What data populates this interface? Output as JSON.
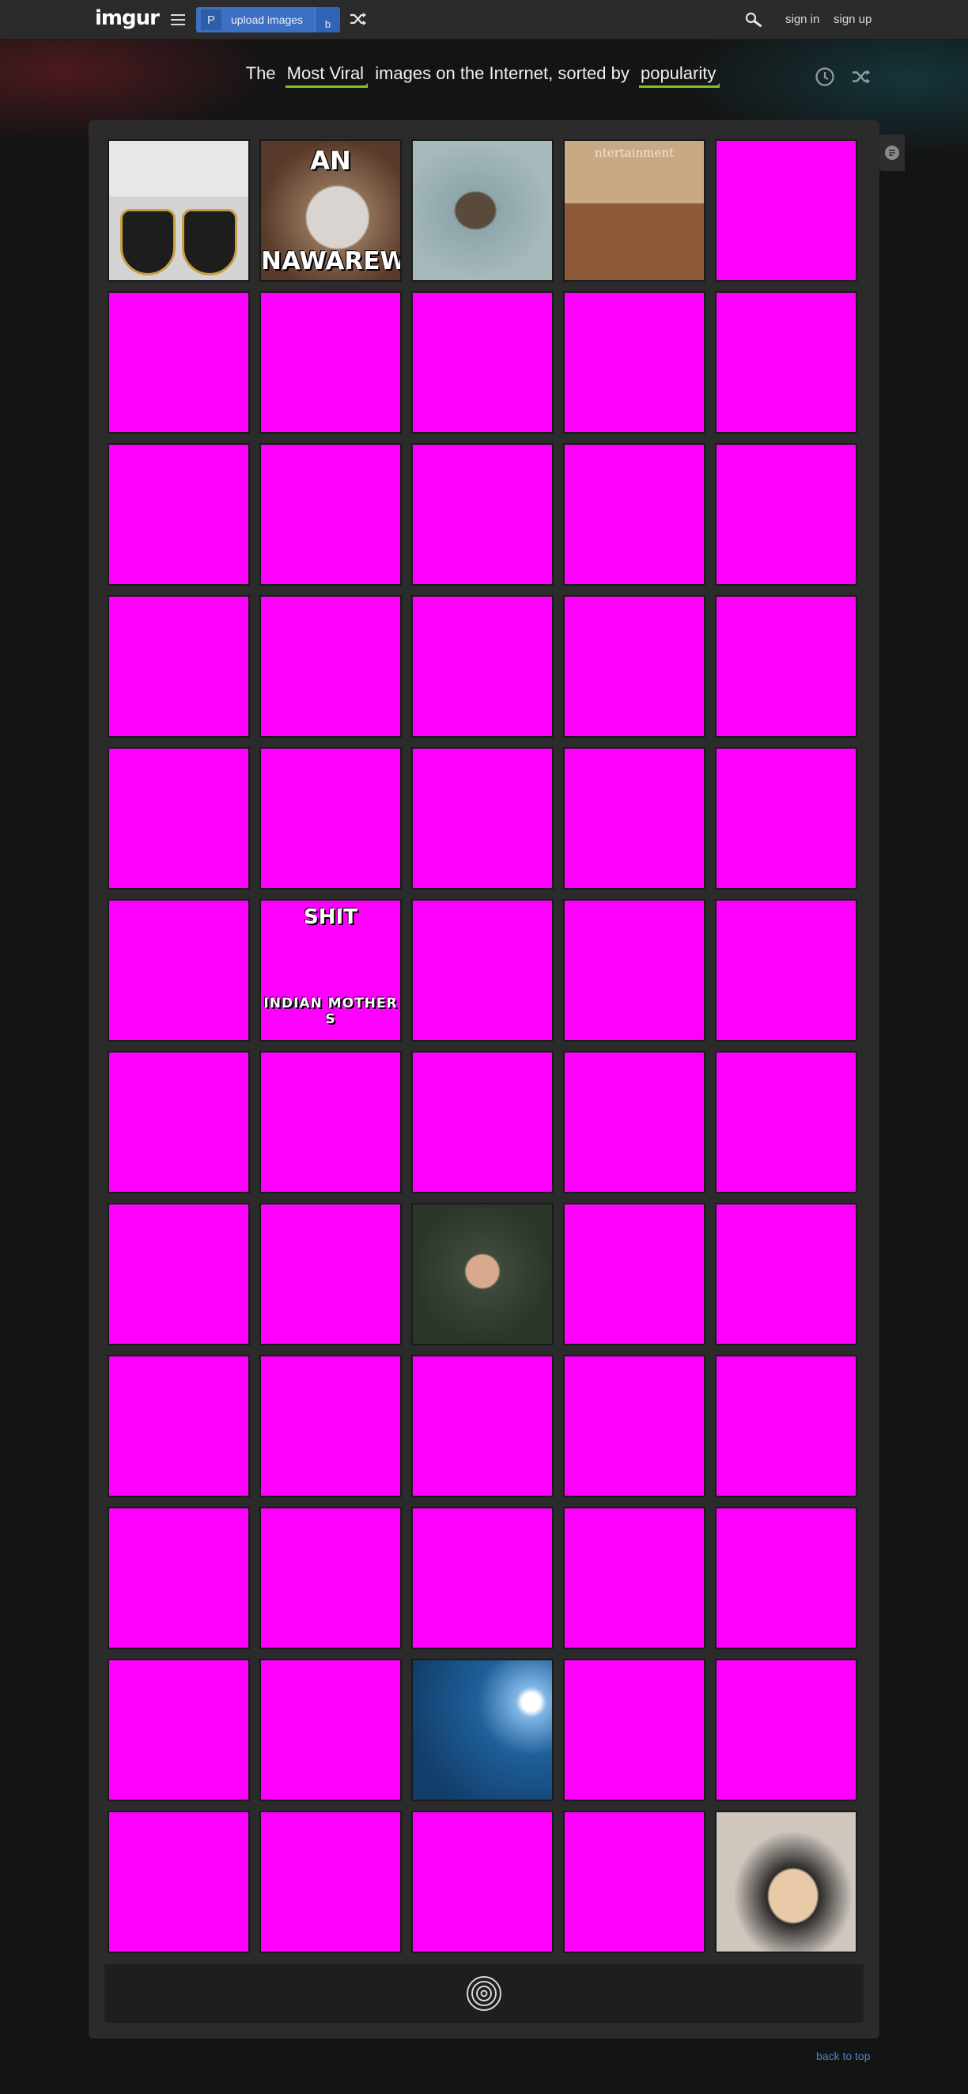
{
  "header": {
    "logo": "imgur",
    "upload_icon_letter": "P",
    "upload_label": "upload images",
    "upload_addon_letter": "b",
    "sign_in": "sign in",
    "sign_up": "sign up",
    "icons": [
      "menu-icon",
      "shuffle-icon",
      "search-icon"
    ]
  },
  "headline": {
    "prefix": "The",
    "section": "Most Viral",
    "middle": "images on the Internet, sorted by",
    "sort": "popularity",
    "icons": [
      "clock-icon",
      "shuffle-icon"
    ]
  },
  "gallery": {
    "tiles": [
      {
        "kind": "badge"
      },
      {
        "kind": "wolf",
        "top_caption": "AN",
        "bottom_caption": "NAWAREWOI"
      },
      {
        "kind": "water"
      },
      {
        "kind": "stage",
        "top_caption": "ntertainment"
      },
      {
        "kind": "magenta"
      },
      {
        "kind": "magenta"
      },
      {
        "kind": "magenta"
      },
      {
        "kind": "magenta"
      },
      {
        "kind": "magenta"
      },
      {
        "kind": "magenta"
      },
      {
        "kind": "magenta"
      },
      {
        "kind": "magenta"
      },
      {
        "kind": "magenta"
      },
      {
        "kind": "magenta"
      },
      {
        "kind": "magenta"
      },
      {
        "kind": "magenta"
      },
      {
        "kind": "magenta"
      },
      {
        "kind": "magenta"
      },
      {
        "kind": "magenta"
      },
      {
        "kind": "magenta"
      },
      {
        "kind": "magenta"
      },
      {
        "kind": "magenta"
      },
      {
        "kind": "magenta"
      },
      {
        "kind": "magenta"
      },
      {
        "kind": "magenta"
      },
      {
        "kind": "magenta"
      },
      {
        "kind": "magenta",
        "top_caption": "SHIT",
        "mid_caption": "INDIAN MOTHER S"
      },
      {
        "kind": "magenta"
      },
      {
        "kind": "magenta"
      },
      {
        "kind": "magenta"
      },
      {
        "kind": "magenta"
      },
      {
        "kind": "magenta"
      },
      {
        "kind": "magenta"
      },
      {
        "kind": "magenta"
      },
      {
        "kind": "magenta"
      },
      {
        "kind": "magenta"
      },
      {
        "kind": "magenta"
      },
      {
        "kind": "soldier"
      },
      {
        "kind": "magenta"
      },
      {
        "kind": "magenta"
      },
      {
        "kind": "magenta"
      },
      {
        "kind": "magenta"
      },
      {
        "kind": "magenta"
      },
      {
        "kind": "magenta"
      },
      {
        "kind": "magenta"
      },
      {
        "kind": "magenta"
      },
      {
        "kind": "magenta"
      },
      {
        "kind": "magenta"
      },
      {
        "kind": "magenta"
      },
      {
        "kind": "magenta"
      },
      {
        "kind": "magenta"
      },
      {
        "kind": "magenta"
      },
      {
        "kind": "blue"
      },
      {
        "kind": "magenta"
      },
      {
        "kind": "magenta"
      },
      {
        "kind": "magenta"
      },
      {
        "kind": "magenta"
      },
      {
        "kind": "magenta"
      },
      {
        "kind": "magenta"
      },
      {
        "kind": "cats"
      }
    ],
    "loader_icon": "spiral-loader-icon"
  },
  "footer": {
    "back_to_top": "back to top"
  },
  "colors": {
    "accent": "#85bf25",
    "upload": "#3d6fc2",
    "placeholder": "#ff00ff",
    "link": "#4f82c4"
  }
}
